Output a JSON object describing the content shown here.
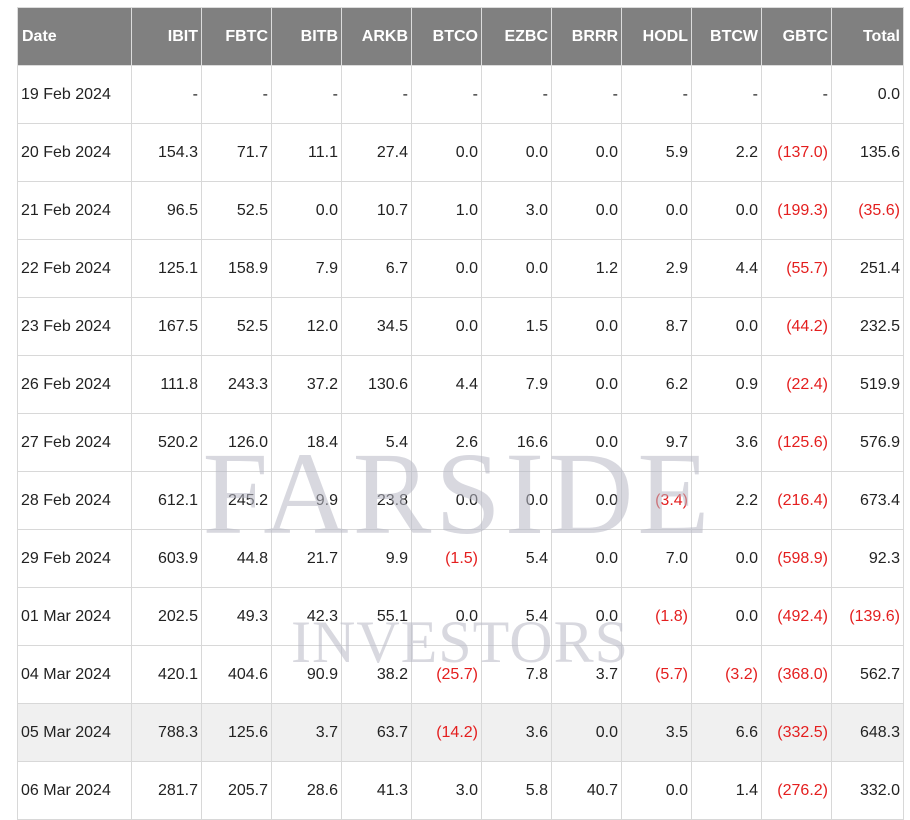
{
  "table": {
    "headers": [
      "Date",
      "IBIT",
      "FBTC",
      "BITB",
      "ARKB",
      "BTCO",
      "EZBC",
      "BRRR",
      "HODL",
      "BTCW",
      "GBTC",
      "Total"
    ],
    "rows": [
      [
        "19 Feb 2024",
        "-",
        "-",
        "-",
        "-",
        "-",
        "-",
        "-",
        "-",
        "-",
        "-",
        "0.0"
      ],
      [
        "20 Feb 2024",
        "154.3",
        "71.7",
        "11.1",
        "27.4",
        "0.0",
        "0.0",
        "0.0",
        "5.9",
        "2.2",
        "(137.0)",
        "135.6"
      ],
      [
        "21 Feb 2024",
        "96.5",
        "52.5",
        "0.0",
        "10.7",
        "1.0",
        "3.0",
        "0.0",
        "0.0",
        "0.0",
        "(199.3)",
        "(35.6)"
      ],
      [
        "22 Feb 2024",
        "125.1",
        "158.9",
        "7.9",
        "6.7",
        "0.0",
        "0.0",
        "1.2",
        "2.9",
        "4.4",
        "(55.7)",
        "251.4"
      ],
      [
        "23 Feb 2024",
        "167.5",
        "52.5",
        "12.0",
        "34.5",
        "0.0",
        "1.5",
        "0.0",
        "8.7",
        "0.0",
        "(44.2)",
        "232.5"
      ],
      [
        "26 Feb 2024",
        "111.8",
        "243.3",
        "37.2",
        "130.6",
        "4.4",
        "7.9",
        "0.0",
        "6.2",
        "0.9",
        "(22.4)",
        "519.9"
      ],
      [
        "27 Feb 2024",
        "520.2",
        "126.0",
        "18.4",
        "5.4",
        "2.6",
        "16.6",
        "0.0",
        "9.7",
        "3.6",
        "(125.6)",
        "576.9"
      ],
      [
        "28 Feb 2024",
        "612.1",
        "245.2",
        "9.9",
        "23.8",
        "0.0",
        "0.0",
        "0.0",
        "(3.4)",
        "2.2",
        "(216.4)",
        "673.4"
      ],
      [
        "29 Feb 2024",
        "603.9",
        "44.8",
        "21.7",
        "9.9",
        "(1.5)",
        "5.4",
        "0.0",
        "7.0",
        "0.0",
        "(598.9)",
        "92.3"
      ],
      [
        "01 Mar 2024",
        "202.5",
        "49.3",
        "42.3",
        "55.1",
        "0.0",
        "5.4",
        "0.0",
        "(1.8)",
        "0.0",
        "(492.4)",
        "(139.6)"
      ],
      [
        "04 Mar 2024",
        "420.1",
        "404.6",
        "90.9",
        "38.2",
        "(25.7)",
        "7.8",
        "3.7",
        "(5.7)",
        "(3.2)",
        "(368.0)",
        "562.7"
      ],
      [
        "05 Mar 2024",
        "788.3",
        "125.6",
        "3.7",
        "63.7",
        "(14.2)",
        "3.6",
        "0.0",
        "3.5",
        "6.6",
        "(332.5)",
        "648.3"
      ],
      [
        "06 Mar 2024",
        "281.7",
        "205.7",
        "28.6",
        "41.3",
        "3.0",
        "5.8",
        "40.7",
        "0.0",
        "1.4",
        "(276.2)",
        "332.0"
      ]
    ],
    "highlighted_row": "05 Mar 2024"
  },
  "watermark": {
    "line1": "FARSIDE",
    "line2": "INVESTORS"
  },
  "colors": {
    "header_bg": "#808080",
    "negative": "#e41e1e",
    "highlight_row": "#f0f0f0"
  }
}
